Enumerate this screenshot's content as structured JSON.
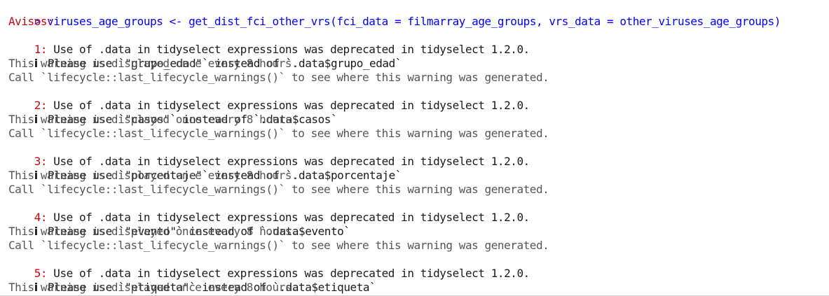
{
  "console": {
    "prompt": "> ",
    "command": "viruses_age_groups <- get_dist_fci_other_vrs(fci_data = filmarray_age_groups, vrs_data = other_viruses_age_groups)",
    "avisos_label": "Avisos:",
    "icon": "info-icon",
    "info_glyph": "i",
    "warnings": [
      {
        "number": "1: ",
        "message": "Use of .data in tidyselect expressions was deprecated in tidyselect 1.2.0.",
        "hint": " Please use `\"grupo_edad\"` instead of `.data$grupo_edad`",
        "note": "This warning is displayed once every 8 hours.",
        "call": "Call `lifecycle::last_lifecycle_warnings()` to see where this warning was generated."
      },
      {
        "number": "2: ",
        "message": "Use of .data in tidyselect expressions was deprecated in tidyselect 1.2.0.",
        "hint": " Please use `\"casos\"` instead of `.data$casos`",
        "note": "This warning is displayed once every 8 hours.",
        "call": "Call `lifecycle::last_lifecycle_warnings()` to see where this warning was generated."
      },
      {
        "number": "3: ",
        "message": "Use of .data in tidyselect expressions was deprecated in tidyselect 1.2.0.",
        "hint": " Please use `\"porcentaje\"` instead of `.data$porcentaje`",
        "note": "This warning is displayed once every 8 hours.",
        "call": "Call `lifecycle::last_lifecycle_warnings()` to see where this warning was generated."
      },
      {
        "number": "4: ",
        "message": "Use of .data in tidyselect expressions was deprecated in tidyselect 1.2.0.",
        "hint": " Please use `\"evento\"` instead of `.data$evento`",
        "note": "This warning is displayed once every 8 hours.",
        "call": "Call `lifecycle::last_lifecycle_warnings()` to see where this warning was generated."
      },
      {
        "number": "5: ",
        "message": "Use of .data in tidyselect expressions was deprecated in tidyselect 1.2.0.",
        "hint": " Please use `\"etiqueta\"` instead of `.data$etiqueta`",
        "note": "This warning is displayed once every 8 hours.",
        "call": ""
      }
    ]
  },
  "colors": {
    "command": "#0000ff",
    "warning": "#c5060b",
    "text": "#1a1a1a",
    "note": "#555555",
    "background": "#ffffff"
  }
}
